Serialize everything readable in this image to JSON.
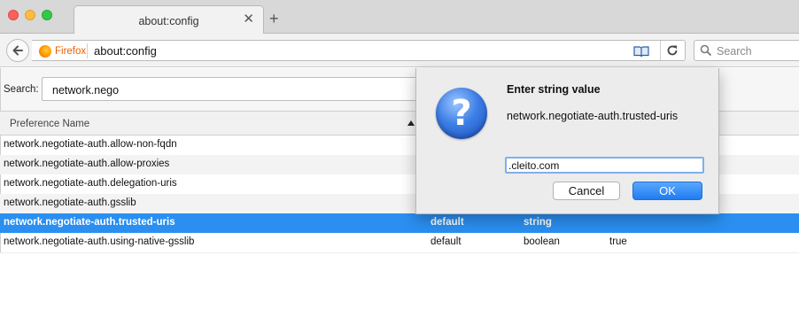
{
  "window": {
    "tab_title": "about:config",
    "tab_close": "✕",
    "new_tab": "+"
  },
  "navbar": {
    "identity_label": "Firefox",
    "url": "about:config",
    "search_placeholder": "Search"
  },
  "config": {
    "search_label": "Search:",
    "search_value": "network.nego",
    "column_name": "Preference Name",
    "rows": [
      {
        "name": "network.negotiate-auth.allow-non-fqdn",
        "status": "",
        "type": "",
        "value": ""
      },
      {
        "name": "network.negotiate-auth.allow-proxies",
        "status": "",
        "type": "",
        "value": ""
      },
      {
        "name": "network.negotiate-auth.delegation-uris",
        "status": "",
        "type": "",
        "value": ""
      },
      {
        "name": "network.negotiate-auth.gsslib",
        "status": "",
        "type": "",
        "value": ""
      },
      {
        "name": "network.negotiate-auth.trusted-uris",
        "status": "default",
        "type": "string",
        "value": ""
      },
      {
        "name": "network.negotiate-auth.using-native-gsslib",
        "status": "default",
        "type": "boolean",
        "value": "true"
      }
    ],
    "selected_row": 4
  },
  "dialog": {
    "title": "Enter string value",
    "message": "network.negotiate-auth.trusted-uris",
    "input_value": ".cleito.com",
    "cancel_label": "Cancel",
    "ok_label": "OK",
    "icon_glyph": "?"
  },
  "colors": {
    "selection": "#2a8ff0",
    "firefox_orange": "#e66000",
    "ok_button": "#1f7cf0"
  }
}
